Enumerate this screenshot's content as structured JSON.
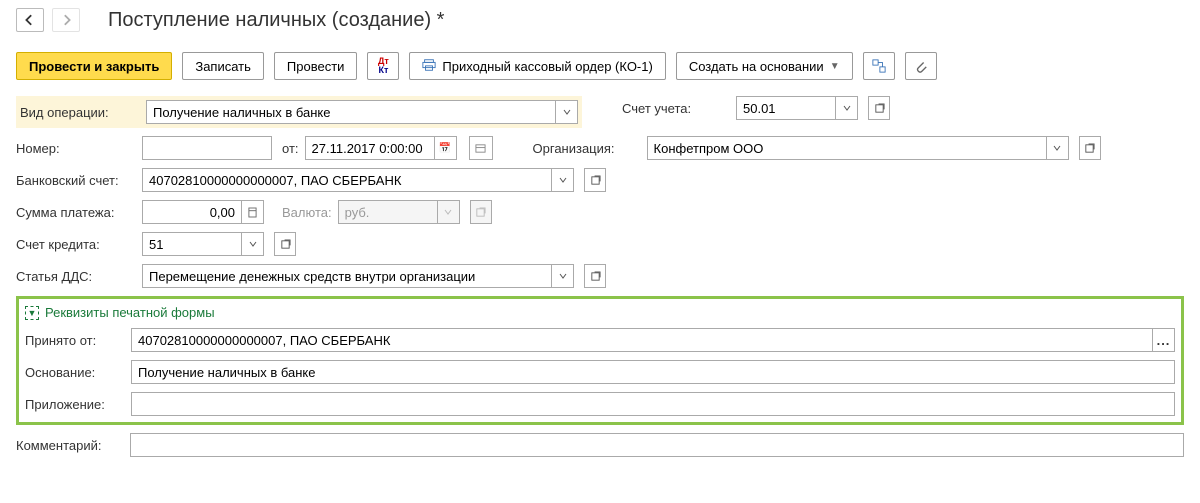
{
  "title": "Поступление наличных (создание) *",
  "toolbar": {
    "submit_close": "Провести и закрыть",
    "save": "Записать",
    "submit": "Провести",
    "print_ko1": "Приходный кассовый ордер (КО-1)",
    "create_based": "Создать на основании"
  },
  "fields": {
    "operation_type_label": "Вид операции:",
    "operation_type_value": "Получение наличных в банке",
    "account_label": "Счет учета:",
    "account_value": "50.01",
    "number_label": "Номер:",
    "number_value": "",
    "from_label": "от:",
    "date_value": "27.11.2017 0:00:00",
    "org_label": "Организация:",
    "org_value": "Конфетпром ООО",
    "bank_acc_label": "Банковский счет:",
    "bank_acc_value": "40702810000000000007, ПАО СБЕРБАНК",
    "sum_label": "Сумма платежа:",
    "sum_value": "0,00",
    "currency_label": "Валюта:",
    "currency_value": "руб.",
    "credit_label": "Счет кредита:",
    "credit_value": "51",
    "dds_label": "Статья ДДС:",
    "dds_value": "Перемещение денежных средств внутри организации",
    "print_form_header": "Реквизиты печатной формы",
    "received_from_label": "Принято от:",
    "received_from_value": "40702810000000000007, ПАО СБЕРБАНК",
    "basis_label": "Основание:",
    "basis_value": "Получение наличных в банке",
    "attachment_label": "Приложение:",
    "attachment_value": "",
    "comment_label": "Комментарий:",
    "comment_value": ""
  }
}
